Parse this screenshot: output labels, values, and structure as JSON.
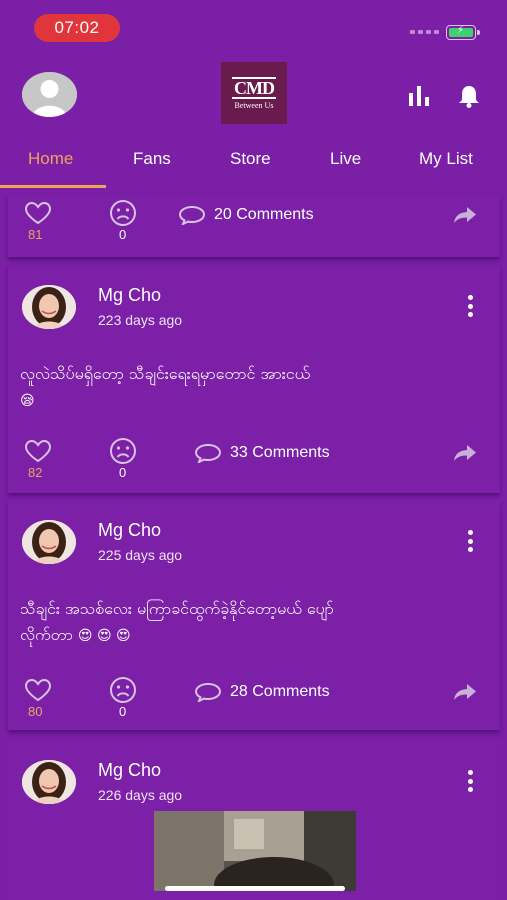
{
  "status_bar": {
    "time": "07:02"
  },
  "header": {
    "logo_mark": "CMD",
    "logo_sub": "Between Us"
  },
  "tabs": [
    {
      "label": "Home",
      "active": true
    },
    {
      "label": "Fans"
    },
    {
      "label": "Store"
    },
    {
      "label": "Live"
    },
    {
      "label": "My List"
    }
  ],
  "first_card": {
    "likes": "81",
    "sad": "0",
    "comments": "20 Comments"
  },
  "posts": [
    {
      "author": "Mg Cho",
      "time": "223 days ago",
      "text": "လူလဲသိပ်မရှိတော့ သီချင်းရေးရမှာတောင် အားငယ်",
      "emojis": "😪",
      "likes": "82",
      "sad": "0",
      "comments": "33 Comments"
    },
    {
      "author": "Mg Cho",
      "time": "225 days ago",
      "text": "သီချင်း အသစ်လေး မကြာခင်ထွက်ခဲ့နိုင်တော့မယ် ပျော်",
      "text2": "လိုက်တာ",
      "emojis": "😍 😍 😍",
      "likes": "80",
      "sad": "0",
      "comments": "28 Comments"
    },
    {
      "author": "Mg Cho",
      "time": "226 days ago"
    }
  ],
  "colors": {
    "background": "#7a1fa6",
    "accent": "#f0a35a",
    "time_pill": "#e0363b",
    "battery": "#3dd26b"
  },
  "icons": [
    "profile-avatar-icon",
    "stats-icon",
    "bell-icon",
    "heart-icon",
    "sad-face-icon",
    "comment-icon",
    "share-icon",
    "more-vertical-icon"
  ]
}
